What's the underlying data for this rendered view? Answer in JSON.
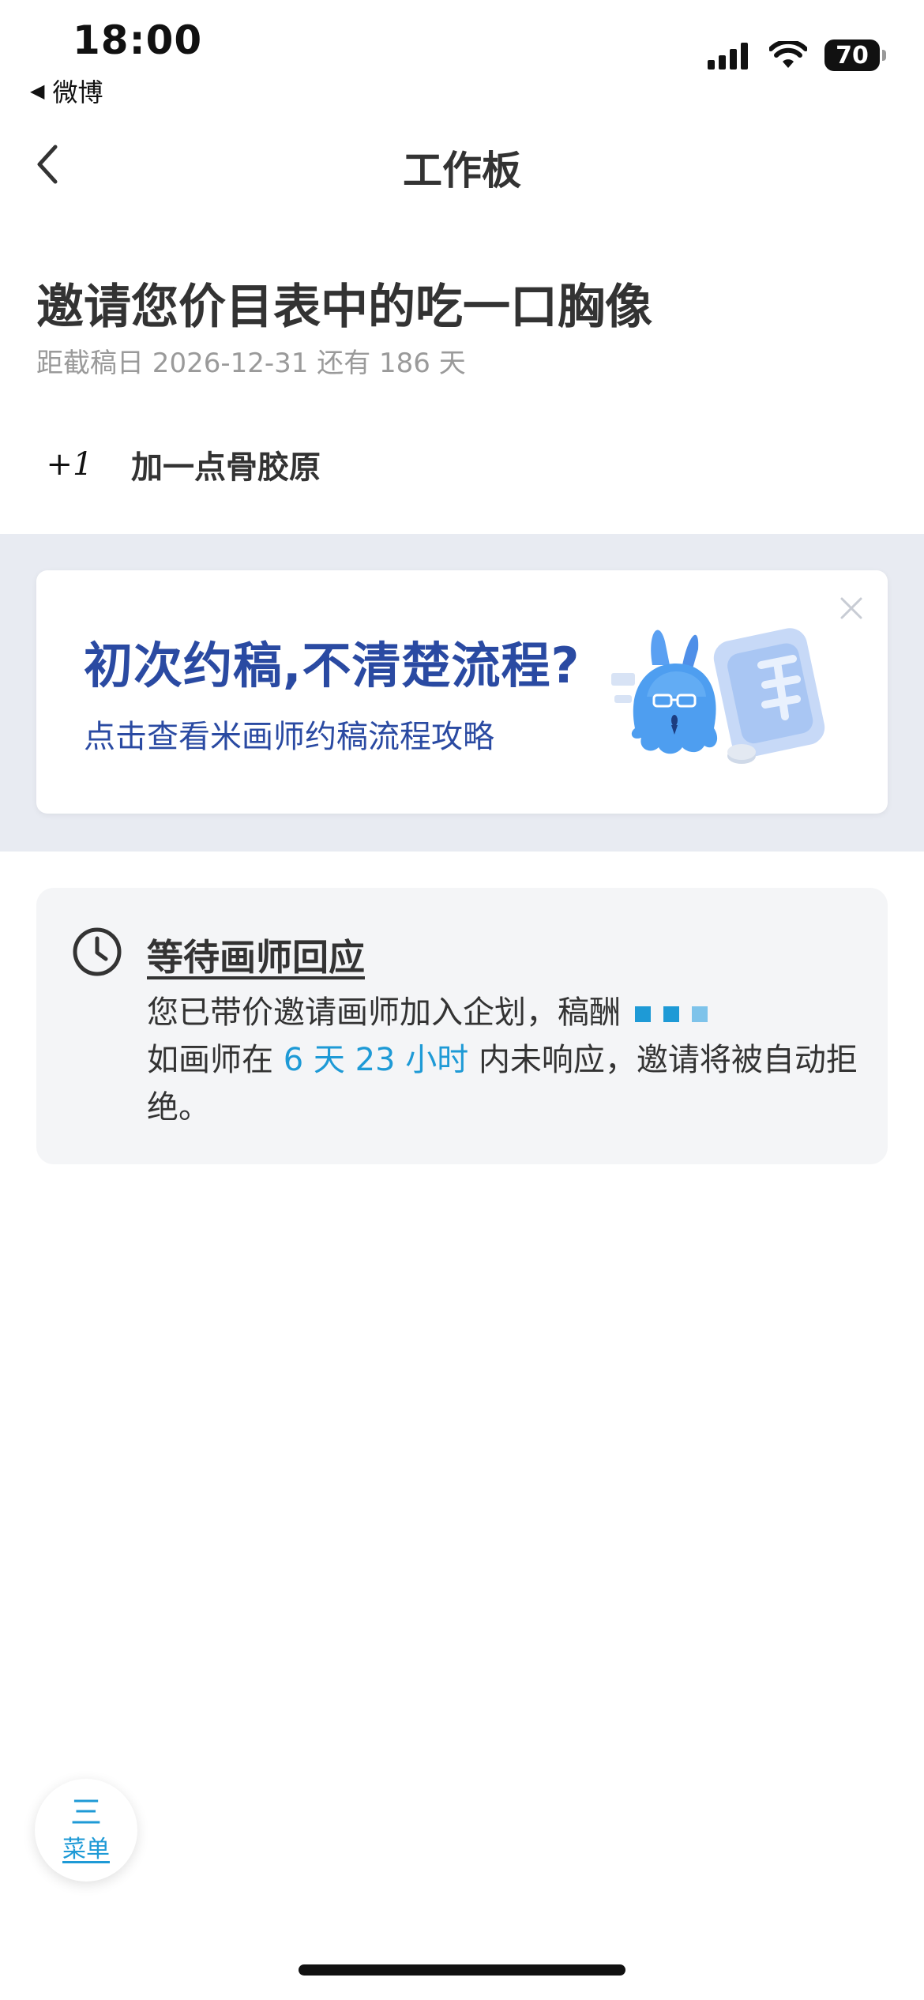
{
  "status_bar": {
    "time": "18:00",
    "back_app": "微博",
    "battery": "70"
  },
  "nav": {
    "title": "工作板"
  },
  "request": {
    "title": "邀请您价目表中的吃一口胸像",
    "deadline": "距截稿日 2026-12-31 还有 186 天"
  },
  "artist": {
    "avatar_text": "+1",
    "name": "加一点骨胶原"
  },
  "banner": {
    "title": "初次约稿,不清楚流程?",
    "subtitle": "点击查看米画师约稿流程攻略"
  },
  "status_card": {
    "title": "等待画师回应",
    "line1": "您已带价邀请画师加入企划，稿酬",
    "line2_prefix": "如画师在",
    "countdown": "6 天 23 小时",
    "line2_suffix": "内未响应，邀请将被自动拒绝。"
  },
  "menu": {
    "icon": "三",
    "label": "菜单"
  },
  "colors": {
    "accent": "#1e9ad6",
    "banner_text": "#2a4aa2",
    "banner_bg": "#e8ebf2",
    "card_bg": "#f4f5f7"
  }
}
